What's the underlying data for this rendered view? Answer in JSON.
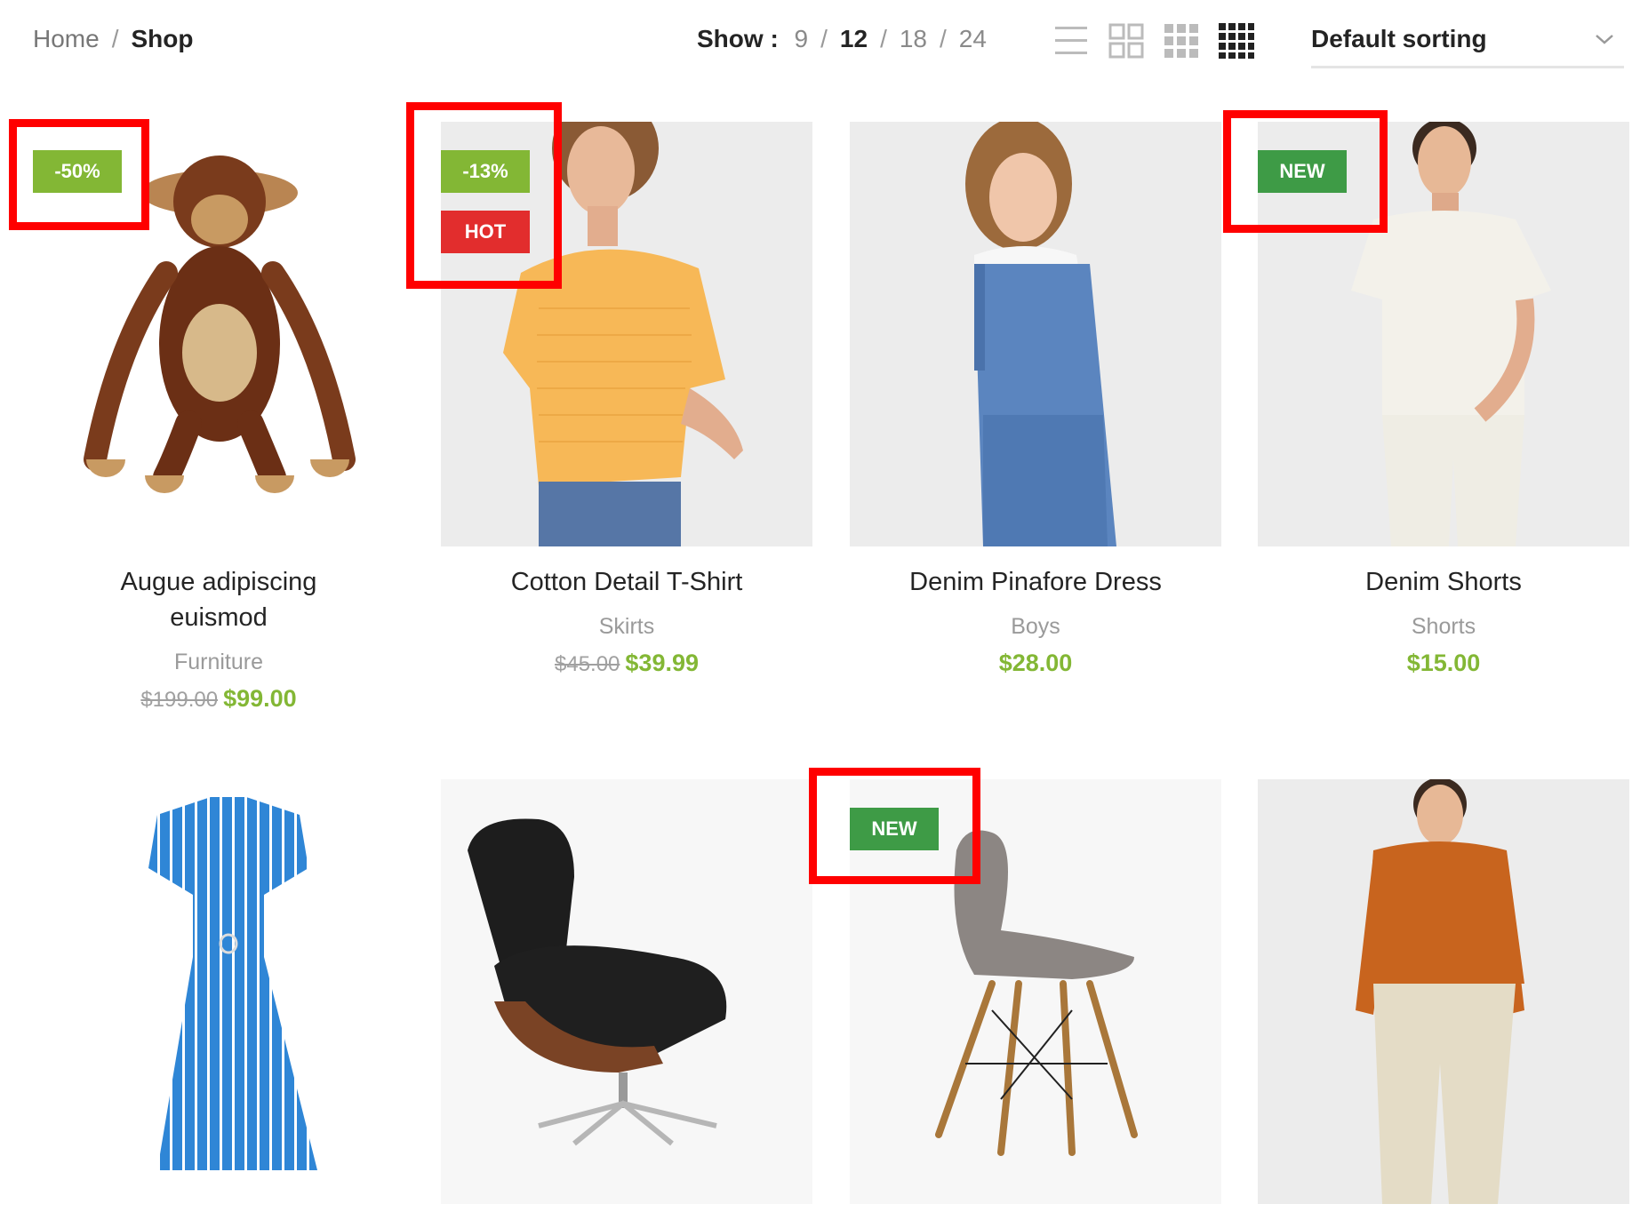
{
  "breadcrumb": {
    "home": "Home",
    "sep": "/",
    "current": "Shop"
  },
  "per_page": {
    "label": "Show :",
    "options": [
      "9",
      "12",
      "18",
      "24"
    ],
    "active": "12",
    "sep": "/"
  },
  "view_icons": [
    "list-view-icon",
    "grid-2-icon",
    "grid-3-icon",
    "grid-4-icon"
  ],
  "sorting": {
    "value": "Default sorting"
  },
  "colors": {
    "accent": "#83b735",
    "hot": "#e22d2d",
    "new": "#3e9b46",
    "highlight": "#ff0000"
  },
  "products": [
    {
      "title_line1": "Augue adipiscing",
      "title_line2": "euismod",
      "category": "Furniture",
      "old_price": "$199.00",
      "price": "$99.00",
      "badges": [
        "-50%"
      ]
    },
    {
      "title_line1": "Cotton Detail T-Shirt",
      "category": "Skirts",
      "old_price": "$45.00",
      "price": "$39.99",
      "badges": [
        "-13%",
        "HOT"
      ]
    },
    {
      "title_line1": "Denim Pinafore Dress",
      "category": "Boys",
      "price": "$28.00",
      "badges": []
    },
    {
      "title_line1": "Denim Shorts",
      "category": "Shorts",
      "price": "$15.00",
      "badges": [
        "NEW"
      ]
    },
    {
      "badges": []
    },
    {
      "badges": []
    },
    {
      "badges": [
        "NEW"
      ]
    },
    {
      "badges": []
    }
  ]
}
